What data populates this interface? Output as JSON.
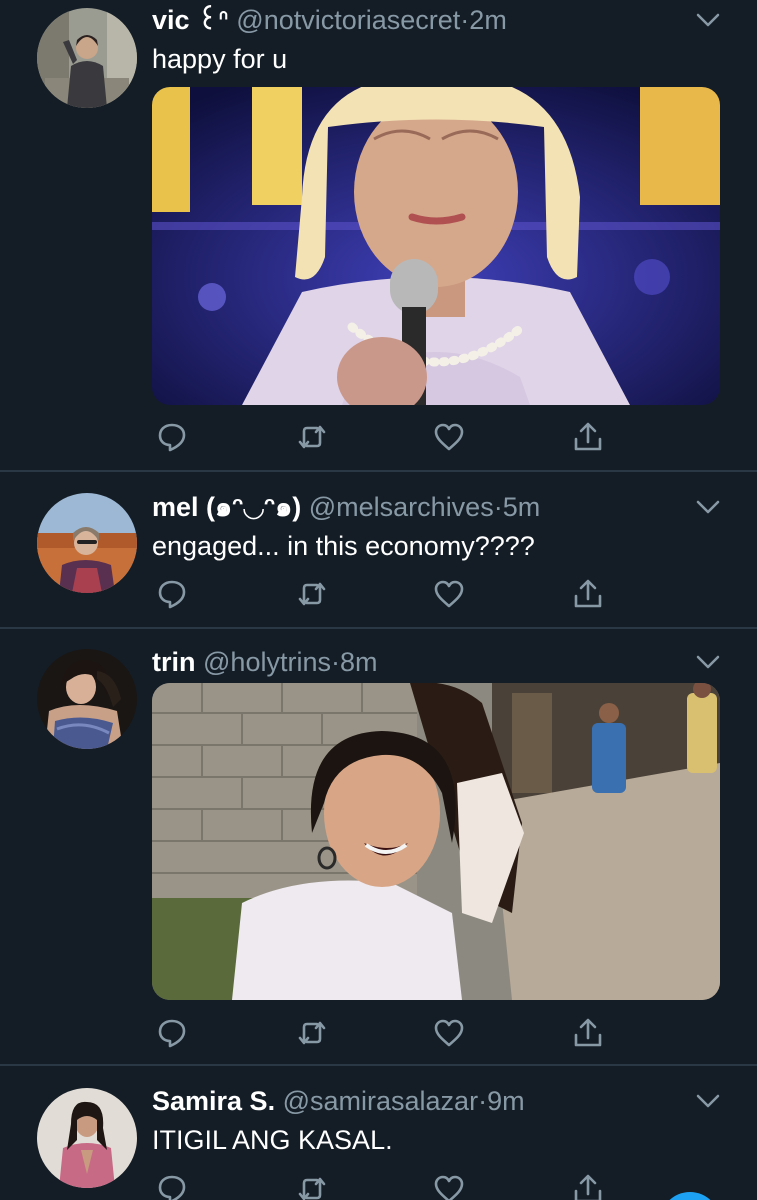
{
  "tweets": [
    {
      "name": "vic ꒰ᐢ",
      "handle": "@notvictoriasecret",
      "separator": "·",
      "time": "2m",
      "text": "happy for u",
      "has_media": true
    },
    {
      "name": "mel (๑ᵔ◡ᵔ๑)",
      "handle": "@melsarchives",
      "separator": "·",
      "time": "5m",
      "text": "engaged... in this economy????",
      "has_media": false
    },
    {
      "name": "trin",
      "handle": "@holytrins",
      "separator": "·",
      "time": "8m",
      "text": "",
      "has_media": true
    },
    {
      "name": "Samira S.",
      "handle": "@samirasalazar",
      "separator": "·",
      "time": "9m",
      "text": "ITIGIL ANG KASAL.",
      "has_media": false
    }
  ],
  "actions": [
    "reply-icon",
    "retweet-icon",
    "like-icon",
    "share-icon"
  ],
  "colors": {
    "background": "#141d26",
    "divider": "#2a3744",
    "secondary_text": "#8899a6",
    "primary_text": "#ffffff",
    "accent": "#1da1f2"
  }
}
